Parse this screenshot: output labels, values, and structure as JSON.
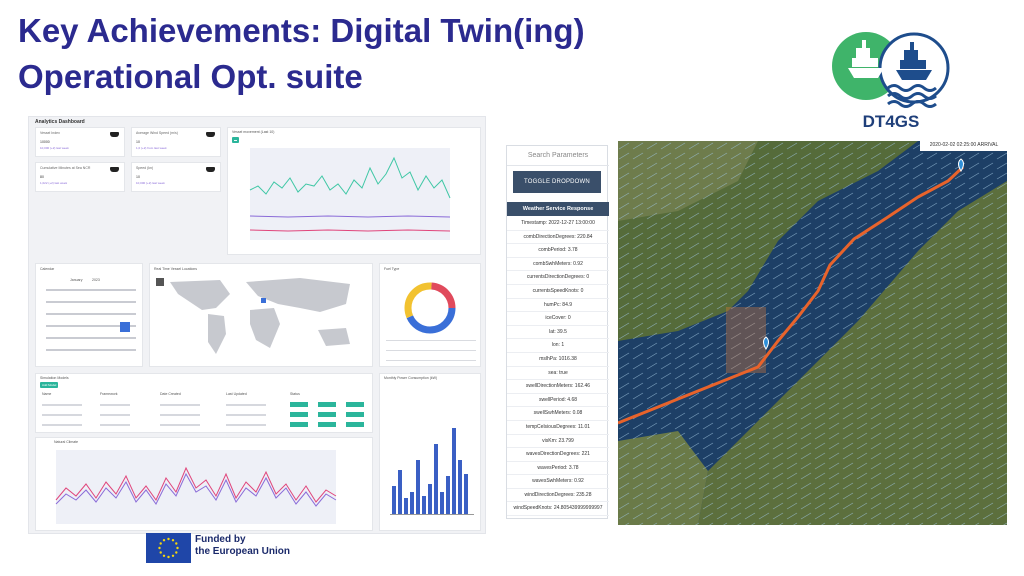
{
  "slide": {
    "title_line1": "Key Achievements: Digital Twin(ing)",
    "title_line2": "Operational Opt. suite",
    "accent": "#2b2a8f"
  },
  "logo": {
    "text": "DT4GS",
    "icon": "twin-ships-waves-icon"
  },
  "dashboard": {
    "title": "Analytics Dashboard",
    "kpis": [
      {
        "label": "Vessel Index",
        "value": "10000",
        "sub": "10,000 (+2) last week"
      },
      {
        "label": "Average Wind Speed (m/s)",
        "value": "10",
        "sub": "1,0 (+2) from last week"
      },
      {
        "label": "Cumulative Minutes at Sea NCR",
        "value": "80",
        "sub": "1,022 (+2) last week"
      },
      {
        "label": "Speed (kn)",
        "value": "10",
        "sub": "10,000 (+2) last week"
      }
    ],
    "chart_top_title": "Vessel movement (Last 10)",
    "calendar_title": "Calendar",
    "calendar_month": "January",
    "calendar_year": "2023",
    "map_title": "Real Time Vessel Locations",
    "fuel_title": "Fuel Type",
    "models_title": "Simulation Models",
    "models_button": "Add Model",
    "models_headers": [
      "Name",
      "Framework",
      "Date Created",
      "Last Updated",
      "Status"
    ],
    "natural_title": "Natural Climate",
    "monthly_title": "Monthly Power Consumption (kW)"
  },
  "weather": {
    "search_placeholder": "Search Parameters",
    "toggle_label": "TOGGLE DROPDOWN",
    "header": "Weather Service Response",
    "rows": [
      "Timestamp: 2022-12-27 13:00:00",
      "combDirectionDegrees: 220.84",
      "combPeriod: 3.78",
      "combSwhMeters: 0.92",
      "currentsDirectionDegrees: 0",
      "currentsSpeedKnots: 0",
      "humPc: 84.9",
      "iceCover: 0",
      "lat: 39.5",
      "lon: 1",
      "mslhPa: 1016.38",
      "sea: true",
      "swellDirectionMeters: 162.46",
      "swellPeriod: 4.68",
      "swellSwhMeters: 0.08",
      "tempCelsiousDegrees: 11.01",
      "visKm: 23.799",
      "wavesDirectionDegrees: 221",
      "wavesPeriod: 3.78",
      "wavesSwhMeters: 0.92",
      "windDirectionDegrees: 235.28",
      "windSpeedKnots: 24.805439999999997"
    ]
  },
  "map": {
    "arrival_label": "2020-02-02 02:25:00 ARRIVAL",
    "route_color": "#e8632b",
    "marker_icon": "map-pin-icon"
  },
  "funding": {
    "line1": "Funded by",
    "line2": "the European Union",
    "flag_icon": "eu-flag-icon"
  }
}
